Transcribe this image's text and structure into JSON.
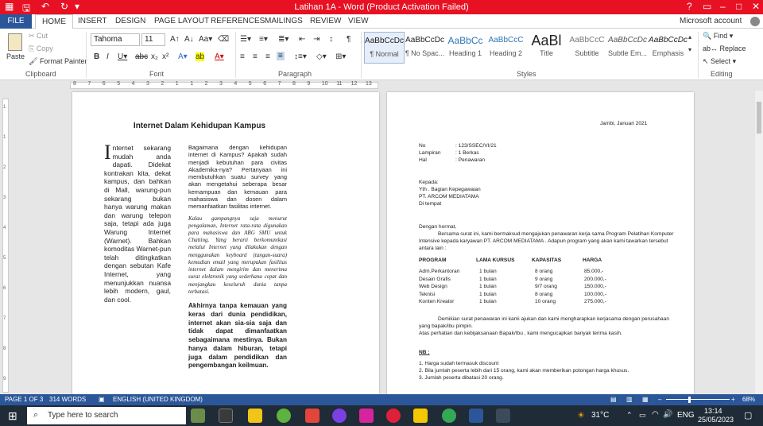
{
  "window": {
    "title": "Latihan 1A - Word (Product Activation Failed)",
    "account": "Microsoft account"
  },
  "tabs": [
    "FILE",
    "HOME",
    "INSERT",
    "DESIGN",
    "PAGE LAYOUT",
    "REFERENCES",
    "MAILINGS",
    "REVIEW",
    "VIEW"
  ],
  "ribbon": {
    "clipboard": {
      "paste": "Paste",
      "cut": "Cut",
      "copy": "Copy",
      "format_painter": "Format Painter",
      "label": "Clipboard"
    },
    "font": {
      "name": "Tahoma",
      "size": "11",
      "label": "Font"
    },
    "paragraph": {
      "label": "Paragraph"
    },
    "styles": {
      "label": "Styles",
      "items": [
        {
          "preview": "AaBbCcDc",
          "name": "¶ Normal"
        },
        {
          "preview": "AaBbCcDc",
          "name": "¶ No Spac..."
        },
        {
          "preview": "AaBbCc",
          "name": "Heading 1"
        },
        {
          "preview": "AaBbCcC",
          "name": "Heading 2"
        },
        {
          "preview": "AaBl",
          "name": "Title"
        },
        {
          "preview": "AaBbCcC",
          "name": "Subtitle"
        },
        {
          "preview": "AaBbCcDc",
          "name": "Subtle Em..."
        },
        {
          "preview": "AaBbCcDc",
          "name": "Emphasis"
        }
      ]
    },
    "editing": {
      "find": "Find",
      "replace": "Replace",
      "select": "Select",
      "label": "Editing"
    }
  },
  "ruler_numbers": [
    "8",
    "7",
    "6",
    "5",
    "4",
    "3",
    "2",
    "1",
    "1",
    "2",
    "3",
    "4",
    "5",
    "6",
    "7",
    "8",
    "9",
    "10",
    "11",
    "12",
    "13"
  ],
  "vruler_numbers": [
    "1",
    "1",
    "2",
    "3",
    "4",
    "5",
    "6",
    "7",
    "8",
    "9"
  ],
  "page1": {
    "title": "Internet Dalam Kehidupan Kampus",
    "col1_dropcap": "I",
    "col1_text": "nternet sekarang mudah anda dapati. Didekat kontrakan kita, dekat kampus, dan bahkan di Mall, warung-pun sekarang bukan hanya warung makan dan warung telepon saja, tetapi ada juga Warung Internet (Warnet). Bahkan komoditas Warnet-pun telah ditingkatkan dengan sebutan Kafe Internet, yang menunjukkan nuansa lebih modern, gaul, dan cool.",
    "col2_p1": "Bagaimana dengan kehidupan internet di Kampus? Apakah sudah menjadi kebutuhan para civitas Akademika-nya? Pertanyaan ini membutuhkan suatu survey yang akan mengetahui seberapa besar kemampuan dan kemauan para mahasiswa dan dosen dalam memanfaatkan fasilitas internet.",
    "col2_p2": "Kalau gampangnya saja menurut pengalaman, Internet rata-rata digunakan para mahasiswa dan ABG SMU untuk Chatting. Yang berarti berkomunikasi melalui Internet yang dilakukan dengan menggunakan keyboard (tangan-suara) kemudian email yang merupakan fasilitas internet dalam mengirim dan menerima surat elektronik yang sederhana cepat dan menjangkau keseluruh dunia tanpa terbatasi.",
    "col2_p3": "Akhirnya tanpa kemauan yang keras dari dunia pendidikan, internet akan sia-sia saja dan tidak dapat dimanfaatkan sebagaimana mestinya. Bukan hanya dalam hiburan, tetapi juga dalam pendidikan dan pengembangan keilmuan."
  },
  "page2": {
    "date": "Jambi, Januari 2021",
    "meta": [
      {
        "label": "No",
        "value": ": 123/SSEC/VI/21"
      },
      {
        "label": "Lampiran",
        "value": ": 1 Berkas"
      },
      {
        "label": "Hal",
        "value": ": Penawaran"
      }
    ],
    "recipient": [
      "Kepada:",
      "Yth . Bagian Kepegawaian",
      "PT. ARCOM MEDIATAMA",
      "Di tempat"
    ],
    "greeting": "Dengan hormat,",
    "intro": [
      "Bersama surat ini, kami bermaksud mengajukan penawaran kerja sama Program Pelatihan Komputer",
      "Intensive kepada karyawan PT. ARCOM MEDIATAMA . Adapun program yang akan kami tawarkan tersebut",
      "antara lain :"
    ],
    "table_headers": [
      "PROGRAM",
      "LAMA KURSUS",
      "KAPASITAS",
      "HARGA"
    ],
    "table_rows": [
      [
        "Adm.Perkantoran",
        "1 bulan",
        "8 orang",
        "85.000,-"
      ],
      [
        "Desain Grafis",
        "1 bulan",
        "9 orang",
        "200.000,-"
      ],
      [
        "Web Design",
        "1 bulan",
        "9/7 orang",
        "150.000,-"
      ],
      [
        "Teknisi",
        "1 bulan",
        "8 orang",
        "100.000,-"
      ],
      [
        "Konten Kreator",
        "1 bulan",
        "10 orang",
        "275.000,-"
      ]
    ],
    "closing": [
      "Demikian surat penawaran ini kami ajukan dan kami mengharapkan kerjasama dengan perusahaan",
      "yang bapak/ibu pimpin.",
      "Atas perhatian dan kebijaksanaan Bapak/Ibu , kami mengucapkan banyak terima kasih."
    ],
    "nb_label": "NB :",
    "nb_items": [
      "1.  Harga sudah termasuk discount",
      "2.  Bila jumlah peserta lebih dari 15 orang, kami akan memberikan potongan harga khusus.",
      "3.  Jumlah peserta dibatasi 20 orang."
    ]
  },
  "status": {
    "page": "PAGE 1 OF 3",
    "words": "314 WORDS",
    "language": "ENGLISH (UNITED KINGDOM)",
    "zoom": "68%"
  },
  "taskbar": {
    "search_placeholder": "Type here to search",
    "temperature": "31°C",
    "language": "ENG",
    "time": "13:14",
    "date": "25/05/2023"
  },
  "colors": {
    "titlebar": "#e81123",
    "accent": "#2b579a",
    "taskbar": "#1f2b36"
  }
}
